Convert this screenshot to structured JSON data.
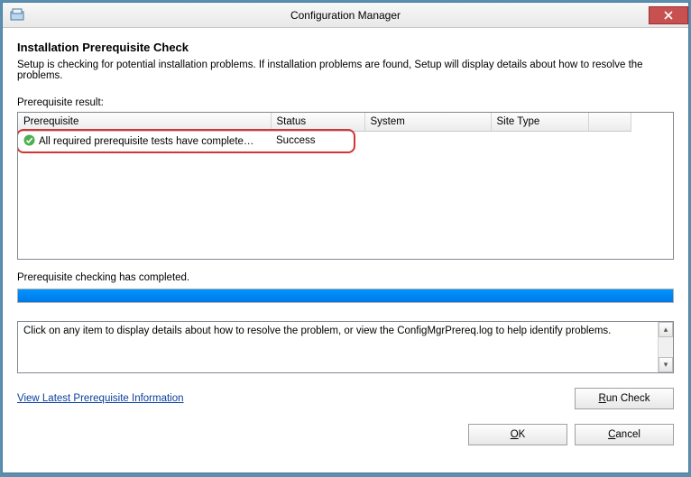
{
  "window": {
    "title": "Configuration Manager"
  },
  "header": {
    "heading": "Installation Prerequisite Check",
    "description": "Setup is checking for potential installation problems. If installation problems are found, Setup will display details about how to resolve the problems."
  },
  "table": {
    "label": "Prerequisite result:",
    "columns": [
      "Prerequisite",
      "Status",
      "System",
      "Site Type"
    ],
    "rows": [
      {
        "prerequisite": "All required prerequisite tests have complete…",
        "status": "Success",
        "system": "",
        "site_type": "",
        "icon": "success"
      }
    ]
  },
  "progress": {
    "label": "Prerequisite checking has completed.",
    "percent": 100
  },
  "details": {
    "text": "Click on any item to display details about how to resolve the problem, or view the ConfigMgrPrereq.log to help identify problems."
  },
  "footer": {
    "link": "View Latest Prerequisite Information",
    "run_check": "Run Check",
    "ok": "OK",
    "cancel": "Cancel"
  }
}
